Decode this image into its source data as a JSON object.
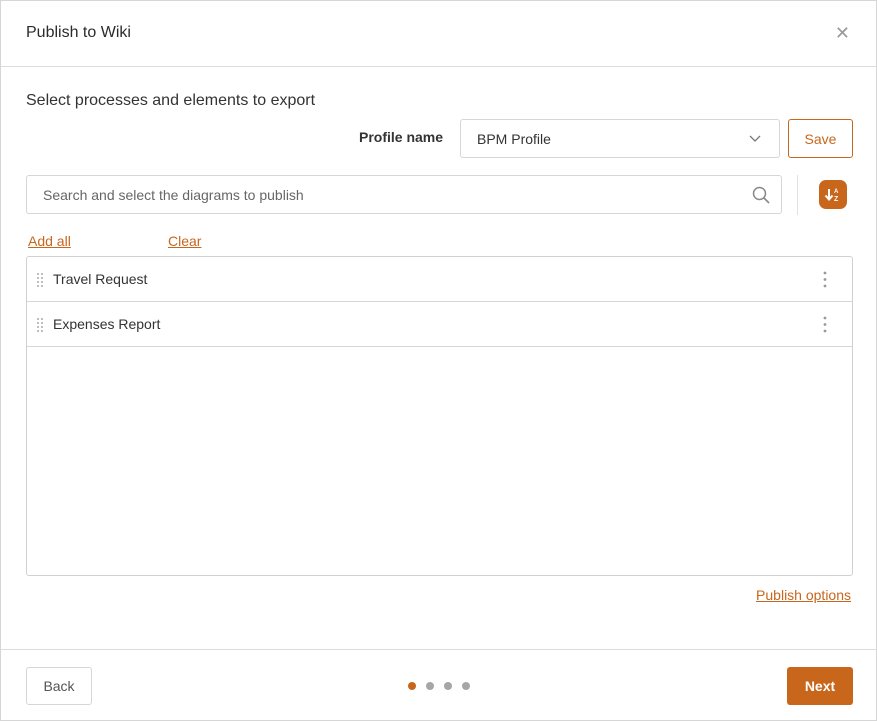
{
  "dialog": {
    "title": "Publish to Wiki",
    "close_icon": "close-icon"
  },
  "main": {
    "subtitle": "Select processes and elements to export",
    "profile": {
      "label": "Profile name",
      "selected": "BPM Profile",
      "dropdown_icon": "chevron-down-icon",
      "save_label": "Save"
    },
    "search": {
      "placeholder": "Search and select the diagrams to publish",
      "value": "",
      "icon": "search-icon"
    },
    "sort_button_icon": "sort-alphabetical-icon",
    "links": {
      "add_all": "Add all",
      "clear": "Clear",
      "publish_options": "Publish options"
    },
    "items": [
      {
        "label": "Travel Request"
      },
      {
        "label": "Expenses Report"
      }
    ]
  },
  "footer": {
    "back_label": "Back",
    "next_label": "Next",
    "steps_total": 4,
    "current_step": 1
  },
  "colors": {
    "accent": "#c8661c",
    "inactive_dot": "#a6a6a6",
    "border": "#d6d6d6"
  }
}
